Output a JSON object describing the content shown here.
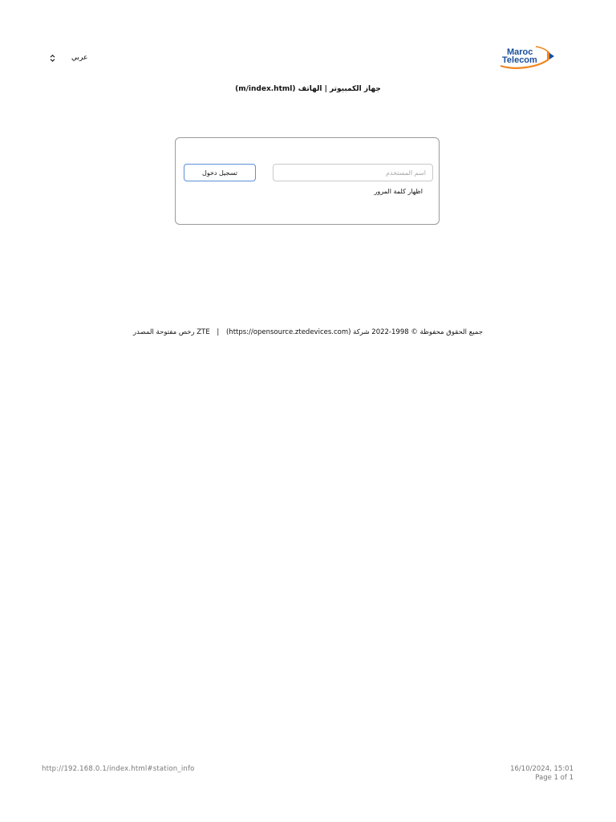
{
  "header": {
    "language": {
      "selected": "عربي"
    },
    "logo": {
      "line1": "Maroc",
      "line2": "Telecom"
    }
  },
  "title": {
    "text": "جهاز الكمبيوتر | الهاتف (m/index.html)"
  },
  "login": {
    "username_placeholder": "اسم المستخدم",
    "username_value": "",
    "login_button": "تسجيل دخول",
    "show_password": "اظهار كلمة المرور"
  },
  "footer": {
    "copyright": "(https://opensource.ztedevices.com) جميع الحقوق محفوظة © 1998-2022 شركة",
    "separator": "|",
    "licenses": "رخص مفتوحة المصدر ZTE"
  },
  "print": {
    "url": "http://192.168.0.1/index.html#station_info",
    "datetime": "16/10/2024, 15:01",
    "page": "Page 1 of 1"
  },
  "colors": {
    "logo_blue": "#1a4e9c",
    "logo_orange": "#f0851d",
    "button_border": "#5b8fd9",
    "card_border": "#9a9a9a"
  }
}
